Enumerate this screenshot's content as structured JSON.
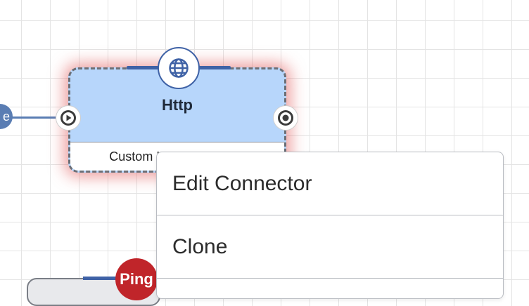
{
  "canvas": {
    "left_node_label": "e",
    "node": {
      "title": "Http",
      "subtitle": "Custom HTML Message",
      "icon": "globe-icon"
    },
    "bottom_node": {
      "badge": "Ping"
    }
  },
  "context_menu": {
    "items": [
      "Edit Connector",
      "Clone"
    ]
  },
  "colors": {
    "node_fill": "#b7d6fb",
    "accent": "#3f62a6",
    "selection_glow": "#de5050",
    "badge": "#c0252a"
  }
}
